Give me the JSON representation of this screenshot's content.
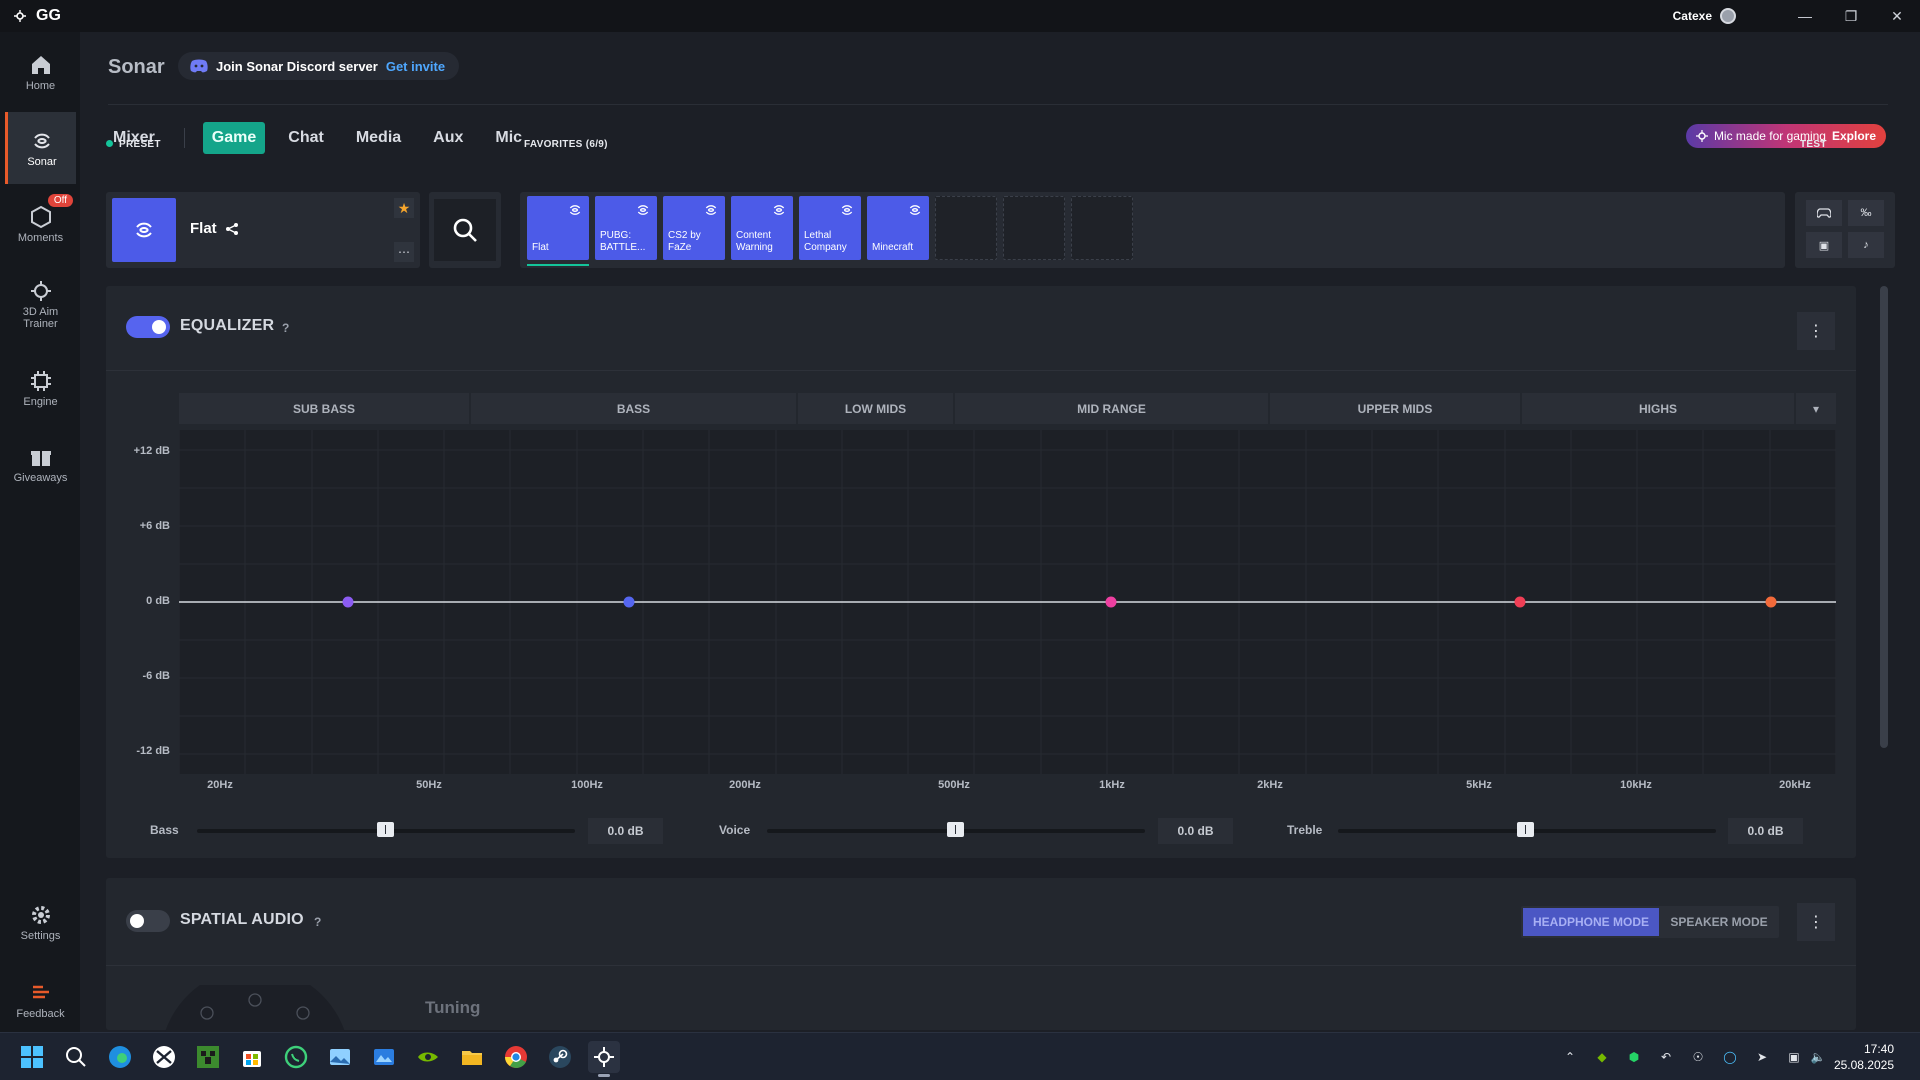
{
  "app": {
    "name": "GG",
    "user": "Catexe"
  },
  "nav": [
    {
      "label": "Home"
    },
    {
      "label": "Sonar"
    },
    {
      "label": "Moments",
      "badge": "Off"
    },
    {
      "label": "3D Aim Trainer"
    },
    {
      "label": "Engine"
    },
    {
      "label": "Giveaways"
    },
    {
      "label": "Settings"
    },
    {
      "label": "Feedback"
    }
  ],
  "header": {
    "title": "Sonar",
    "discord_text": "Join Sonar Discord server",
    "discord_link": "Get invite"
  },
  "tabs": [
    "Mixer",
    "Game",
    "Chat",
    "Media",
    "Aux",
    "Mic"
  ],
  "active_tab": "Game",
  "promo": {
    "text": "Mic made for gaming",
    "link": "Explore"
  },
  "preset": {
    "section": "PRESET",
    "name": "Flat"
  },
  "favorites": {
    "title": "FAVORITES (6/9)",
    "items": [
      "Flat",
      "PUBG: BATTLE...",
      "CS2 by FaZe",
      "Content Warning",
      "Lethal Company",
      "Minecraft"
    ]
  },
  "test": {
    "title": "TEST"
  },
  "equalizer": {
    "title": "EQUALIZER",
    "help": "?",
    "enabled": true,
    "bands": [
      "SUB BASS",
      "BASS",
      "LOW MIDS",
      "MID RANGE",
      "UPPER MIDS",
      "HIGHS"
    ],
    "y_labels": [
      "+12 dB",
      "+6 dB",
      "0 dB",
      "-6 dB",
      "-12 dB"
    ],
    "x_labels": [
      "20Hz",
      "50Hz",
      "100Hz",
      "200Hz",
      "500Hz",
      "1kHz",
      "2kHz",
      "5kHz",
      "10kHz",
      "20kHz"
    ],
    "point_colors": [
      "#8c5cf2",
      "#5566f0",
      "#ee3fa0",
      "#f03e55",
      "#f26a3a"
    ],
    "sliders": [
      {
        "label": "Bass",
        "value": "0.0 dB"
      },
      {
        "label": "Voice",
        "value": "0.0 dB"
      },
      {
        "label": "Treble",
        "value": "0.0 dB"
      }
    ]
  },
  "spatial": {
    "title": "SPATIAL AUDIO",
    "help": "?",
    "enabled": false,
    "modes": [
      "HEADPHONE MODE",
      "SPEAKER MODE"
    ],
    "tuning_title": "Tuning"
  },
  "clock": {
    "time": "17:40",
    "date": "25.08.2025"
  },
  "colors": {
    "accent_green": "#14a58a",
    "accent_blue": "#4c5be8",
    "brand_orange": "#e85a2a"
  }
}
